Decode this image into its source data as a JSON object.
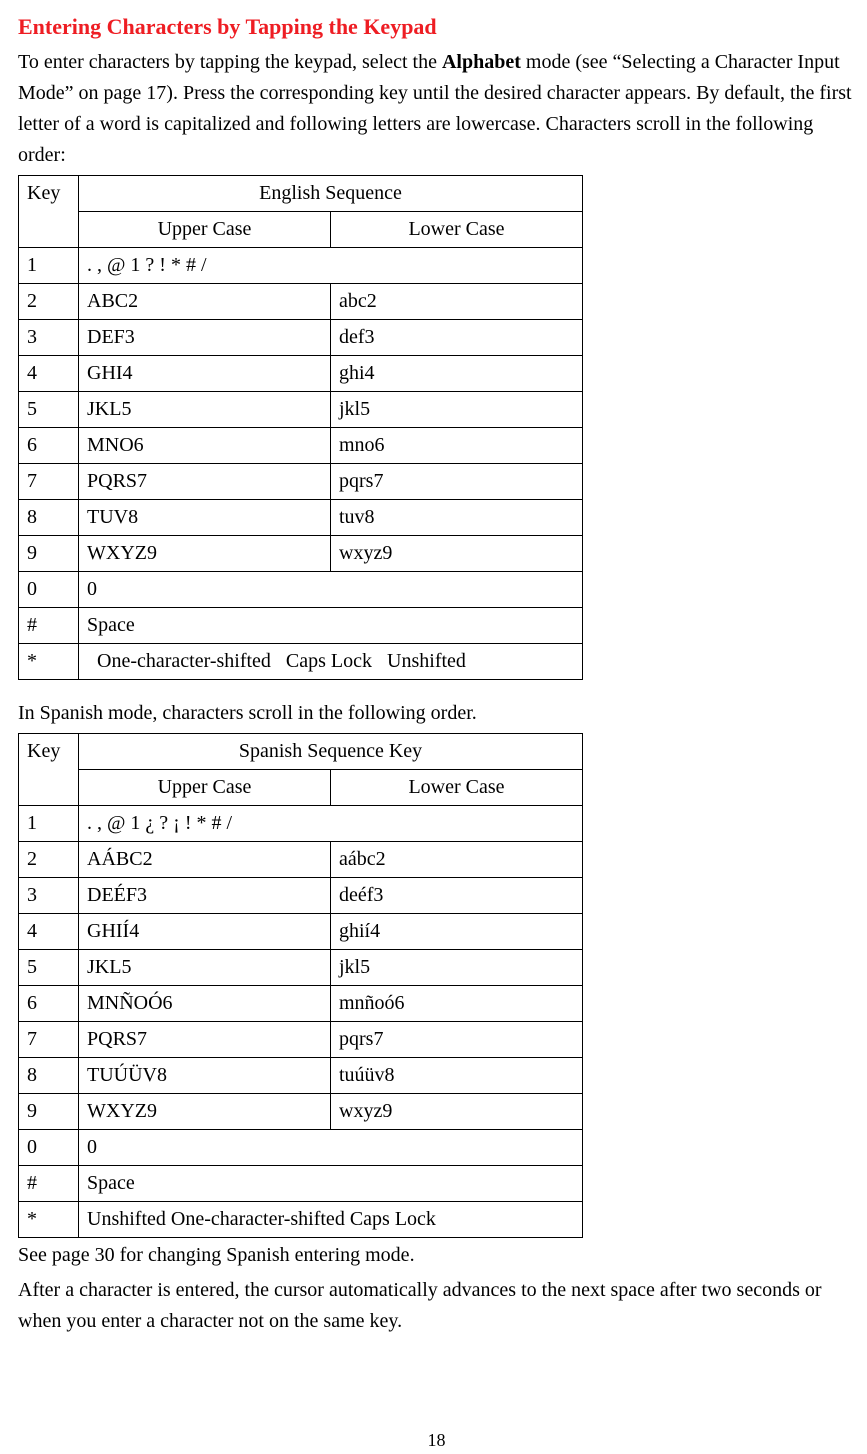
{
  "heading": "Entering Characters by Tapping the Keypad",
  "intro_part1": "To enter characters by tapping the keypad, select the ",
  "intro_bold": "Alphabet",
  "intro_part2": " mode (see “Selecting a Character Input Mode” on page 17). Press the corresponding key until the desired character appears. By default, the first letter of a word is capitalized and following letters are lowercase. Characters scroll in the following order:",
  "table1": {
    "header_key": "Key",
    "header_seq": "English Sequence",
    "header_upper": "Upper Case",
    "header_lower": "Lower Case",
    "rows": [
      {
        "key": "1",
        "span": ". , @ 1 ? ! * # /"
      },
      {
        "key": "2",
        "upper": "ABC2",
        "lower": "abc2"
      },
      {
        "key": "3",
        "upper": "DEF3",
        "lower": "def3"
      },
      {
        "key": "4",
        "upper": "GHI4",
        "lower": "ghi4"
      },
      {
        "key": "5",
        "upper": "JKL5",
        "lower": "jkl5"
      },
      {
        "key": "6",
        "upper": "MNO6",
        "lower": "mno6"
      },
      {
        "key": "7",
        "upper": "PQRS7",
        "lower": "pqrs7"
      },
      {
        "key": "8",
        "upper": "TUV8",
        "lower": "tuv8"
      },
      {
        "key": "9",
        "upper": "WXYZ9",
        "lower": "wxyz9"
      },
      {
        "key": "0",
        "span": "0"
      },
      {
        "key": "#",
        "span": "Space"
      },
      {
        "key": "*",
        "span": "  One-character-shifted   Caps Lock   Unshifted"
      }
    ]
  },
  "spanish_intro": "In Spanish mode, characters scroll in the following order.",
  "table2": {
    "header_key": "Key",
    "header_seq": "Spanish Sequence Key",
    "header_upper": "Upper Case",
    "header_lower": "Lower Case",
    "rows": [
      {
        "key": "1",
        "span": ". , @ 1 ¿ ? ¡ ! * # /"
      },
      {
        "key": "2",
        "upper": "AÁBC2",
        "lower": "aábc2"
      },
      {
        "key": "3",
        "upper": "DEÉF3",
        "lower": "deéf3"
      },
      {
        "key": "4",
        "upper": "GHIÍ4",
        "lower": "ghií4"
      },
      {
        "key": "5",
        "upper": "JKL5",
        "lower": "jkl5"
      },
      {
        "key": "6",
        "upper": "MNÑOÓ6",
        "lower": "mnñoó6"
      },
      {
        "key": "7",
        "upper": "PQRS7",
        "lower": "pqrs7"
      },
      {
        "key": "8",
        "upper": "TUÚÜV8",
        "lower": "tuúüv8"
      },
      {
        "key": "9",
        "upper": "WXYZ9",
        "lower": "wxyz9"
      },
      {
        "key": "0",
        "span": "0"
      },
      {
        "key": "#",
        "span": "Space"
      },
      {
        "key": "*",
        "span": "Unshifted One-character-shifted Caps Lock"
      }
    ]
  },
  "see_page": "See page 30 for changing Spanish entering mode.",
  "after_char": "After a character is entered, the cursor automatically advances to the next space after two seconds or when you enter a character not on the same key.",
  "page_number": "18"
}
